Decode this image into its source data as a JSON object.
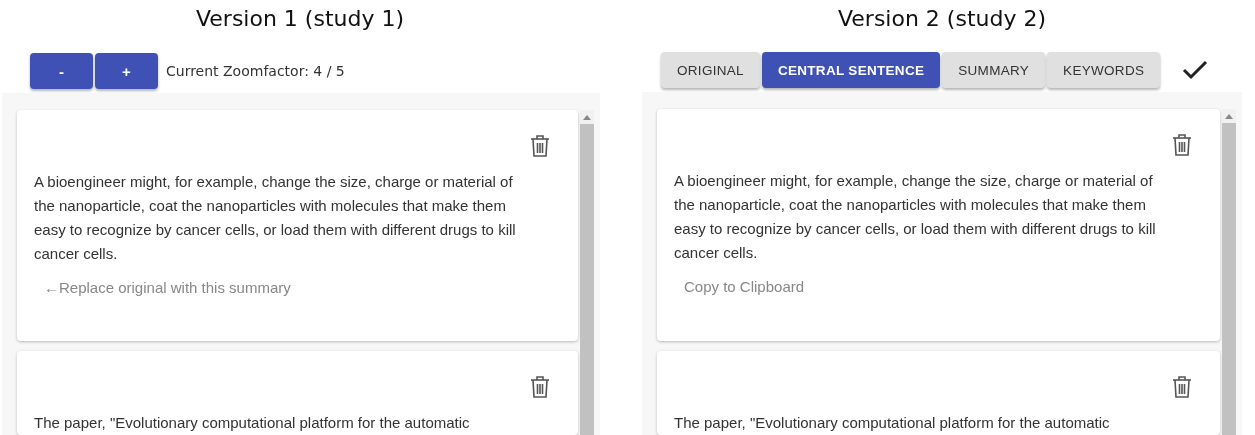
{
  "columns": [
    {
      "title": "Version 1 (study 1)",
      "toolbar": {
        "kind": "zoom",
        "buttons": [
          "-",
          "+"
        ],
        "label": "Current Zoomfactor: 4 / 5"
      },
      "cards": [
        {
          "text": "A bioengineer might, for example, change the size, charge or material of the nanoparticle, coat the nanoparticles with molecules that make them easy to recognize by cancer cells, or load them with different drugs to kill cancer cells.",
          "action": "←Replace original with this summary"
        },
        {
          "text": "The paper, \"Evolutionary computational platform for the automatic"
        }
      ]
    },
    {
      "title": "Version 2 (study 2)",
      "toolbar": {
        "kind": "tabs",
        "tabs": [
          {
            "label": "ORIGINAL",
            "selected": false
          },
          {
            "label": "CENTRAL SENTENCE",
            "selected": true
          },
          {
            "label": "SUMMARY",
            "selected": false
          },
          {
            "label": "KEYWORDS",
            "selected": false
          }
        ]
      },
      "cards": [
        {
          "text": "A bioengineer might, for example, change the size, charge or material of the nanoparticle, coat the nanoparticles with molecules that make them easy to recognize by cancer cells, or load them with different drugs to kill cancer cells.",
          "action": "Copy to Clipboard"
        },
        {
          "text": "The paper, \"Evolutionary computational platform for the automatic"
        }
      ]
    }
  ]
}
